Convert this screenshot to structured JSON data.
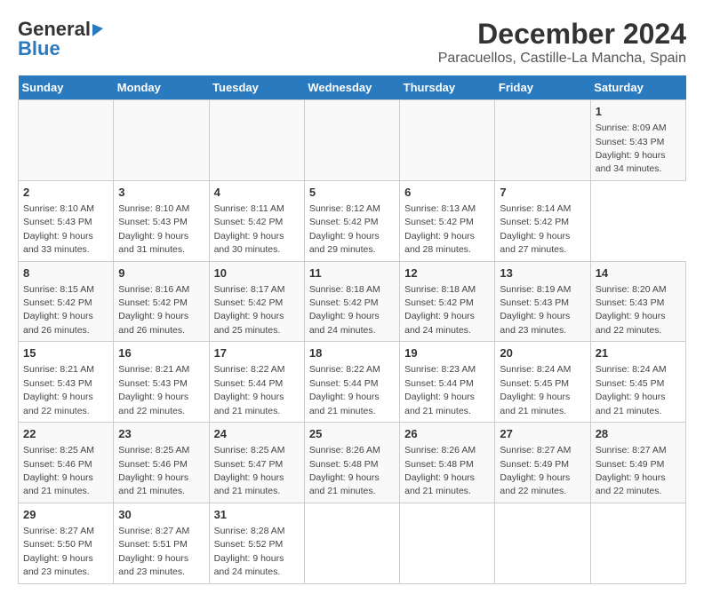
{
  "header": {
    "logo_general": "General",
    "logo_blue": "Blue",
    "month_title": "December 2024",
    "location": "Paracuellos, Castille-La Mancha, Spain"
  },
  "calendar": {
    "days_of_week": [
      "Sunday",
      "Monday",
      "Tuesday",
      "Wednesday",
      "Thursday",
      "Friday",
      "Saturday"
    ],
    "weeks": [
      [
        null,
        null,
        null,
        null,
        null,
        null,
        {
          "day": "1",
          "sunrise": "Sunrise: 8:09 AM",
          "sunset": "Sunset: 5:43 PM",
          "daylight": "Daylight: 9 hours and 34 minutes."
        }
      ],
      [
        {
          "day": "2",
          "sunrise": "Sunrise: 8:10 AM",
          "sunset": "Sunset: 5:43 PM",
          "daylight": "Daylight: 9 hours and 33 minutes."
        },
        {
          "day": "3",
          "sunrise": "Sunrise: 8:10 AM",
          "sunset": "Sunset: 5:43 PM",
          "daylight": "Daylight: 9 hours and 31 minutes."
        },
        {
          "day": "4",
          "sunrise": "Sunrise: 8:11 AM",
          "sunset": "Sunset: 5:42 PM",
          "daylight": "Daylight: 9 hours and 30 minutes."
        },
        {
          "day": "5",
          "sunrise": "Sunrise: 8:12 AM",
          "sunset": "Sunset: 5:42 PM",
          "daylight": "Daylight: 9 hours and 29 minutes."
        },
        {
          "day": "6",
          "sunrise": "Sunrise: 8:13 AM",
          "sunset": "Sunset: 5:42 PM",
          "daylight": "Daylight: 9 hours and 28 minutes."
        },
        {
          "day": "7",
          "sunrise": "Sunrise: 8:14 AM",
          "sunset": "Sunset: 5:42 PM",
          "daylight": "Daylight: 9 hours and 27 minutes."
        }
      ],
      [
        {
          "day": "8",
          "sunrise": "Sunrise: 8:15 AM",
          "sunset": "Sunset: 5:42 PM",
          "daylight": "Daylight: 9 hours and 26 minutes."
        },
        {
          "day": "9",
          "sunrise": "Sunrise: 8:16 AM",
          "sunset": "Sunset: 5:42 PM",
          "daylight": "Daylight: 9 hours and 26 minutes."
        },
        {
          "day": "10",
          "sunrise": "Sunrise: 8:17 AM",
          "sunset": "Sunset: 5:42 PM",
          "daylight": "Daylight: 9 hours and 25 minutes."
        },
        {
          "day": "11",
          "sunrise": "Sunrise: 8:18 AM",
          "sunset": "Sunset: 5:42 PM",
          "daylight": "Daylight: 9 hours and 24 minutes."
        },
        {
          "day": "12",
          "sunrise": "Sunrise: 8:18 AM",
          "sunset": "Sunset: 5:42 PM",
          "daylight": "Daylight: 9 hours and 24 minutes."
        },
        {
          "day": "13",
          "sunrise": "Sunrise: 8:19 AM",
          "sunset": "Sunset: 5:43 PM",
          "daylight": "Daylight: 9 hours and 23 minutes."
        },
        {
          "day": "14",
          "sunrise": "Sunrise: 8:20 AM",
          "sunset": "Sunset: 5:43 PM",
          "daylight": "Daylight: 9 hours and 22 minutes."
        }
      ],
      [
        {
          "day": "15",
          "sunrise": "Sunrise: 8:21 AM",
          "sunset": "Sunset: 5:43 PM",
          "daylight": "Daylight: 9 hours and 22 minutes."
        },
        {
          "day": "16",
          "sunrise": "Sunrise: 8:21 AM",
          "sunset": "Sunset: 5:43 PM",
          "daylight": "Daylight: 9 hours and 22 minutes."
        },
        {
          "day": "17",
          "sunrise": "Sunrise: 8:22 AM",
          "sunset": "Sunset: 5:44 PM",
          "daylight": "Daylight: 9 hours and 21 minutes."
        },
        {
          "day": "18",
          "sunrise": "Sunrise: 8:22 AM",
          "sunset": "Sunset: 5:44 PM",
          "daylight": "Daylight: 9 hours and 21 minutes."
        },
        {
          "day": "19",
          "sunrise": "Sunrise: 8:23 AM",
          "sunset": "Sunset: 5:44 PM",
          "daylight": "Daylight: 9 hours and 21 minutes."
        },
        {
          "day": "20",
          "sunrise": "Sunrise: 8:24 AM",
          "sunset": "Sunset: 5:45 PM",
          "daylight": "Daylight: 9 hours and 21 minutes."
        },
        {
          "day": "21",
          "sunrise": "Sunrise: 8:24 AM",
          "sunset": "Sunset: 5:45 PM",
          "daylight": "Daylight: 9 hours and 21 minutes."
        }
      ],
      [
        {
          "day": "22",
          "sunrise": "Sunrise: 8:25 AM",
          "sunset": "Sunset: 5:46 PM",
          "daylight": "Daylight: 9 hours and 21 minutes."
        },
        {
          "day": "23",
          "sunrise": "Sunrise: 8:25 AM",
          "sunset": "Sunset: 5:46 PM",
          "daylight": "Daylight: 9 hours and 21 minutes."
        },
        {
          "day": "24",
          "sunrise": "Sunrise: 8:25 AM",
          "sunset": "Sunset: 5:47 PM",
          "daylight": "Daylight: 9 hours and 21 minutes."
        },
        {
          "day": "25",
          "sunrise": "Sunrise: 8:26 AM",
          "sunset": "Sunset: 5:48 PM",
          "daylight": "Daylight: 9 hours and 21 minutes."
        },
        {
          "day": "26",
          "sunrise": "Sunrise: 8:26 AM",
          "sunset": "Sunset: 5:48 PM",
          "daylight": "Daylight: 9 hours and 21 minutes."
        },
        {
          "day": "27",
          "sunrise": "Sunrise: 8:27 AM",
          "sunset": "Sunset: 5:49 PM",
          "daylight": "Daylight: 9 hours and 22 minutes."
        },
        {
          "day": "28",
          "sunrise": "Sunrise: 8:27 AM",
          "sunset": "Sunset: 5:49 PM",
          "daylight": "Daylight: 9 hours and 22 minutes."
        }
      ],
      [
        {
          "day": "29",
          "sunrise": "Sunrise: 8:27 AM",
          "sunset": "Sunset: 5:50 PM",
          "daylight": "Daylight: 9 hours and 23 minutes."
        },
        {
          "day": "30",
          "sunrise": "Sunrise: 8:27 AM",
          "sunset": "Sunset: 5:51 PM",
          "daylight": "Daylight: 9 hours and 23 minutes."
        },
        {
          "day": "31",
          "sunrise": "Sunrise: 8:28 AM",
          "sunset": "Sunset: 5:52 PM",
          "daylight": "Daylight: 9 hours and 24 minutes."
        },
        null,
        null,
        null,
        null
      ]
    ]
  }
}
